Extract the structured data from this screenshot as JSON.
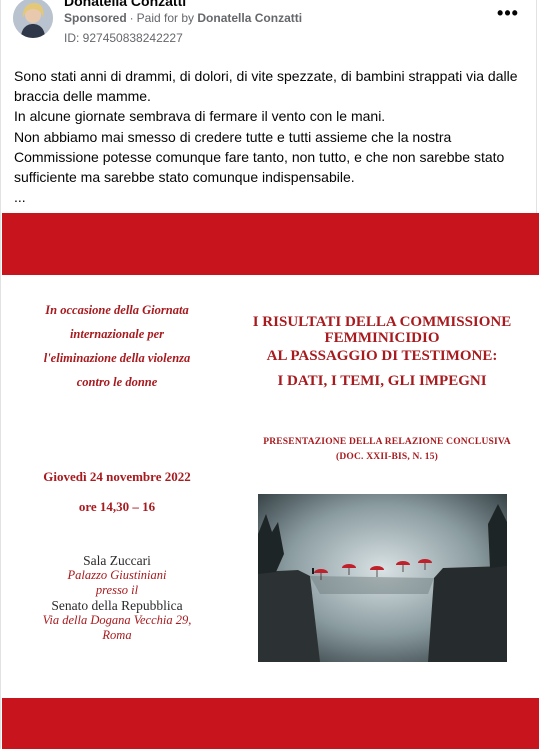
{
  "post": {
    "author": "Donatella Conzatti",
    "sponsored_label": "Sponsored",
    "separator": "·",
    "paid_for_prefix": "Paid for by",
    "paid_for_name": "Donatella Conzatti",
    "ad_id": "ID: 927450838242227",
    "more_icon": "•••",
    "body_lines": [
      "Sono stati anni di drammi, di dolori, di vite spezzate, di bambini strappati via dalle braccia delle mamme.",
      "In alcune giornate sembrava di fermare il vento con le mani.",
      "Non abbiamo mai smesso di credere tutte e tutti assieme che la nostra Commissione potesse comunque fare tanto, non tutto, e che non sarebbe stato sufficiente ma sarebbe stato comunque indispensabile.",
      "..."
    ]
  },
  "poster": {
    "intro": "In occasione della Giornata internazionale per l'eliminazione della violenza contro le donne",
    "title_line1": "I RISULTATI DELLA COMMISSIONE",
    "title_line2": "FEMMINICIDIO",
    "title_line3": "AL PASSAGGIO DI TESTIMONE:",
    "title_line4": "I DATI,  I TEMI, GLI IMPEGNI",
    "presentation_line1": "PRESENTAZIONE DELLA RELAZIONE CONCLUSIVA",
    "presentation_line2": "(DOC. XXII-BIS, N. 15)",
    "date": "Giovedì 24 novembre 2022",
    "time": "ore 14,30 – 16",
    "venue_name": "Sala Zuccari",
    "venue_building": "Palazzo Giustiniani",
    "venue_presso": "presso il",
    "venue_senate": "Senato della Repubblica",
    "venue_address": "Via della Dogana Vecchia 29,",
    "venue_city": "Roma"
  },
  "colors": {
    "brand_red": "#c8141c",
    "text_red": "#a71a1e"
  }
}
